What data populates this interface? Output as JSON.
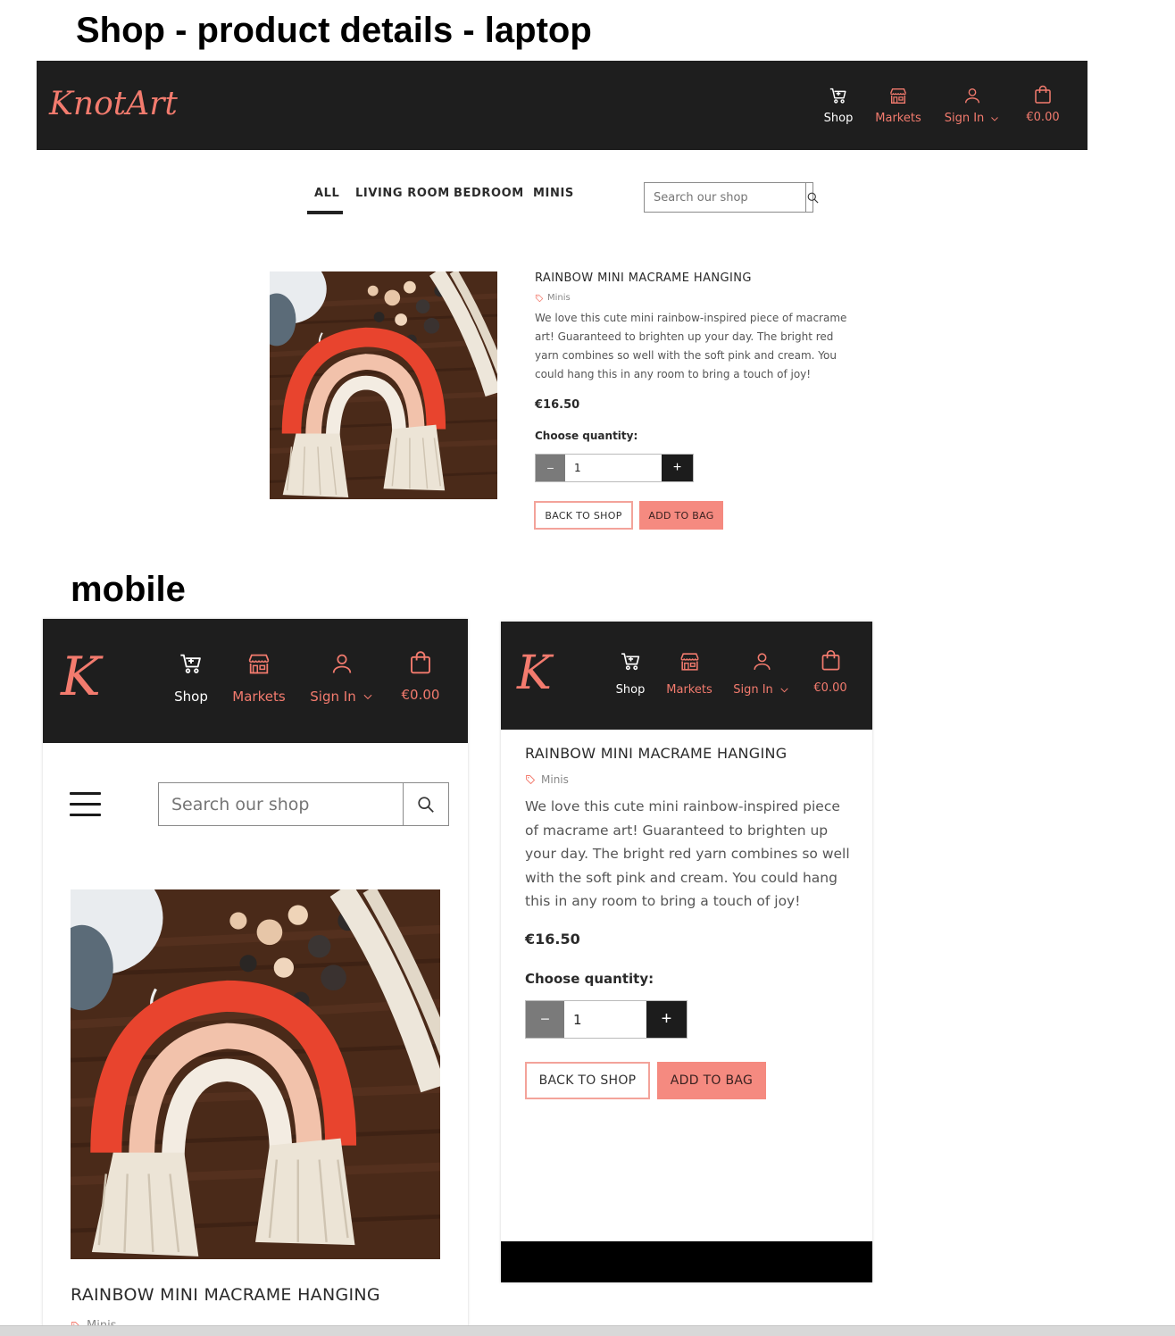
{
  "headings": {
    "laptop": "Shop - product details - laptop",
    "mobile": "mobile"
  },
  "brand": {
    "logo_text": "KnotArt",
    "logo_short": "K",
    "accent_color": "#f37b6e",
    "nav_bg": "#1e1e1e"
  },
  "nav": {
    "shop": {
      "label": "Shop",
      "icon": "cart-icon"
    },
    "markets": {
      "label": "Markets",
      "icon": "storefront-icon"
    },
    "signin": {
      "label": "Sign In",
      "icon": "user-icon"
    },
    "bag": {
      "label": "€0.00",
      "icon": "shopping-bag-icon"
    }
  },
  "categories": [
    {
      "label": "ALL",
      "active": true
    },
    {
      "label": "LIVING ROOM",
      "active": false
    },
    {
      "label": "BEDROOM",
      "active": false
    },
    {
      "label": "MINIS",
      "active": false
    }
  ],
  "search": {
    "placeholder": "Search our shop"
  },
  "product": {
    "title": "RAINBOW MINI MACRAME HANGING",
    "category": "Minis",
    "description": "We love this cute mini rainbow-inspired piece of macrame art! Guaranteed to brighten up your day. The bright red yarn combines so well with the soft pink and cream. You could hang this in any room to bring a touch of joy!",
    "price": "€16.50",
    "quantity_label": "Choose quantity:",
    "quantity_value": "1",
    "minus_symbol": "−",
    "plus_symbol": "+",
    "back_button": "BACK TO SHOP",
    "add_button": "ADD TO BAG",
    "truncated_category": "Minis"
  }
}
